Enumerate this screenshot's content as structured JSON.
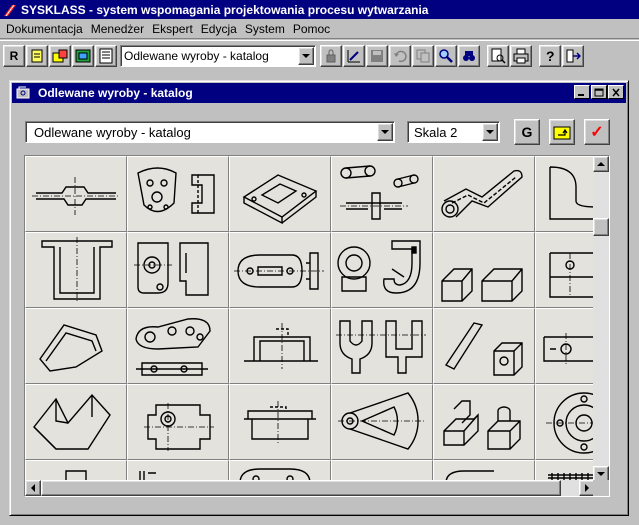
{
  "app": {
    "title": "SYSKLASS - system  wspomagania projektowania procesu wytwarzania"
  },
  "menu": [
    "Dokumentacja",
    "Menedżer",
    "Ekspert",
    "Edycja",
    "System",
    "Pomoc"
  ],
  "toolbar": {
    "r_label": "R",
    "catalog_value": "Odlewane wyroby - katalog"
  },
  "window": {
    "title": "Odlewane wyroby - katalog",
    "catalog_select": "Odlewane wyroby - katalog",
    "scale_select": "Skala 2",
    "g_button": "G",
    "ok_glyph": "✓"
  },
  "colors": {
    "title_bar": "#000080",
    "face": "#c0c0c0",
    "grid_bg": "#e4e2dc",
    "ok_check": "#ff0000",
    "folder_button": "#ffff00"
  },
  "icons": {
    "app": "sysklass-logo-icon",
    "window": "catalog-window-icon",
    "toolbar": [
      "r-icon",
      "new-document-icon",
      "open-folder-icon",
      "catalog-icon",
      "form-icon",
      "lock-icon",
      "edit-chart-icon",
      "save-disk-icon",
      "undo-icon",
      "copy-icon",
      "search-icon",
      "find-icon",
      "print-preview-icon",
      "print-icon",
      "help-icon",
      "exit-icon"
    ]
  },
  "grid": {
    "columns": 6,
    "rows": 5,
    "thumbnails": [
      "flange-section",
      "bracket-plate",
      "rectangular-base",
      "linkage-assembly",
      "bent-lever",
      "curved-plate",
      "channel-section",
      "gear-bracket",
      "oval-flange",
      "hook-block",
      "square-tubes",
      "rail-section",
      "angled-block",
      "cam-lever",
      "cover-section",
      "clevis-pair",
      "pin-block",
      "grooved-plate",
      "v-block",
      "housing",
      "cover-plate",
      "sector-arm",
      "stepped-blocks",
      "round-flange",
      "small-part-a",
      "small-part-b",
      "small-part-c",
      "empty",
      "small-part-d",
      "hatched-part"
    ]
  }
}
